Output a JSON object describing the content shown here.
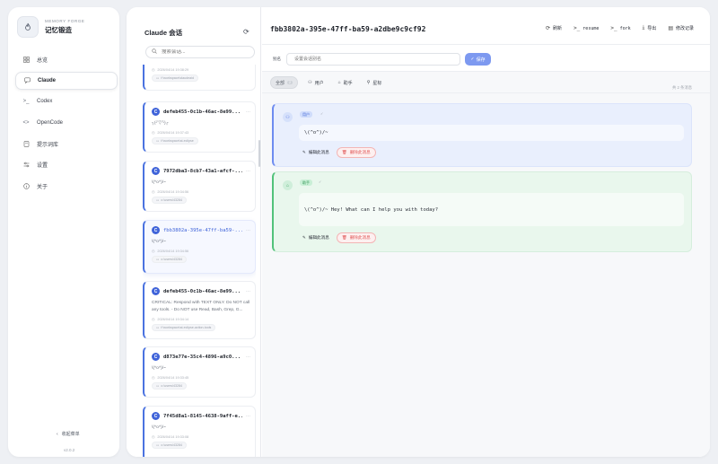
{
  "brand": {
    "small": "MEMORY FORGE",
    "title": "记忆锻造"
  },
  "nav": [
    {
      "label": "总览",
      "icon": "grid-icon"
    },
    {
      "label": "Claude",
      "icon": "chat-icon",
      "active": true
    },
    {
      "label": "Codex",
      "icon": "terminal-icon"
    },
    {
      "label": "OpenCode",
      "icon": "code-icon"
    },
    {
      "label": "提示词库",
      "icon": "book-icon"
    },
    {
      "label": "设置",
      "icon": "sliders-icon"
    },
    {
      "label": "关于",
      "icon": "info-icon"
    }
  ],
  "sidebar_footer": {
    "collapse_label": "收起菜单",
    "version": "v2.0.2"
  },
  "list": {
    "title": "Claude 会话",
    "search_placeholder": "搜索会话...",
    "cards": [
      {
        "title": "",
        "preview": "",
        "time": "2026/04/14 19:38:29",
        "path": "f:\\workspace\\claudeaid"
      },
      {
        "title": "defeb455-0c1b-46ac-8e99...",
        "preview": "╮(╯▽╰)╭",
        "time": "2026/04/14 19:37:43",
        "path": "f:\\workspace\\ai-eclipse"
      },
      {
        "title": "7972dba3-8cb7-43a1-afcf-...",
        "preview": "\\(^o^)/~",
        "time": "2026/04/14 19:34:56",
        "path": "c:\\users\\43284"
      },
      {
        "title": "fbb3802a-395e-47ff-ba59-...",
        "preview": "\\(^o^)/~",
        "time": "2026/04/14 19:34:56",
        "path": "c:\\users\\43284",
        "active": true
      },
      {
        "title": "defeb455-0c1b-46ac-8e99...",
        "preview": "CRITICAL: Respond with TEXT ONLY. Do NOT call any tools. - Do NOT use Read, Bash, Grep, G...",
        "time": "2026/04/14 19:34:14",
        "path": "f:\\workspace\\ai-eclipse-action-tools"
      },
      {
        "title": "d873e77e-35c4-4896-a9c0...",
        "preview": "\\(^o^)/~",
        "time": "2026/04/14 19:33:45",
        "path": "c:\\users\\43284"
      },
      {
        "title": "7f45d8a1-8145-4638-9aff-e...",
        "preview": "\\(^o^)/~",
        "time": "2026/04/14 19:33:08",
        "path": "c:\\users\\43284"
      }
    ]
  },
  "header": {
    "session_id": "fbb3802a-395e-47ff-ba59-a2dbe9c9cf92",
    "actions": [
      {
        "label": "刷新",
        "icon": "refresh-icon"
      },
      {
        "label": "resume",
        "icon": "terminal-icon"
      },
      {
        "label": "fork",
        "icon": "terminal-icon"
      },
      {
        "label": "导出",
        "icon": "download-icon"
      },
      {
        "label": "修改记录",
        "icon": "file-icon"
      }
    ]
  },
  "alias": {
    "label": "别名",
    "placeholder": "设置会话别名",
    "save_label": "保存"
  },
  "filters": [
    {
      "label": "全部",
      "count": "2",
      "active": true,
      "icon": ""
    },
    {
      "label": "用户",
      "icon": "user-icon"
    },
    {
      "label": "助手",
      "icon": "bot-icon"
    },
    {
      "label": "星标",
      "icon": "pin-icon"
    }
  ],
  "message_count": "共 2 条消息",
  "messages": [
    {
      "role": "user",
      "role_label": "用户",
      "text": "\\(^o^)/~",
      "edit_label": "编辑此消息",
      "delete_label": "删除此消息"
    },
    {
      "role": "assistant",
      "role_label": "助手",
      "text": "\\(^o^)/~ Hey! What can I help you with today?",
      "edit_label": "编辑此消息",
      "delete_label": "删除此消息"
    }
  ],
  "colors": {
    "accent": "#4a72e0",
    "user_bg": "#e9effd",
    "assistant_bg": "#e9f7ed",
    "delete": "#e05454"
  }
}
